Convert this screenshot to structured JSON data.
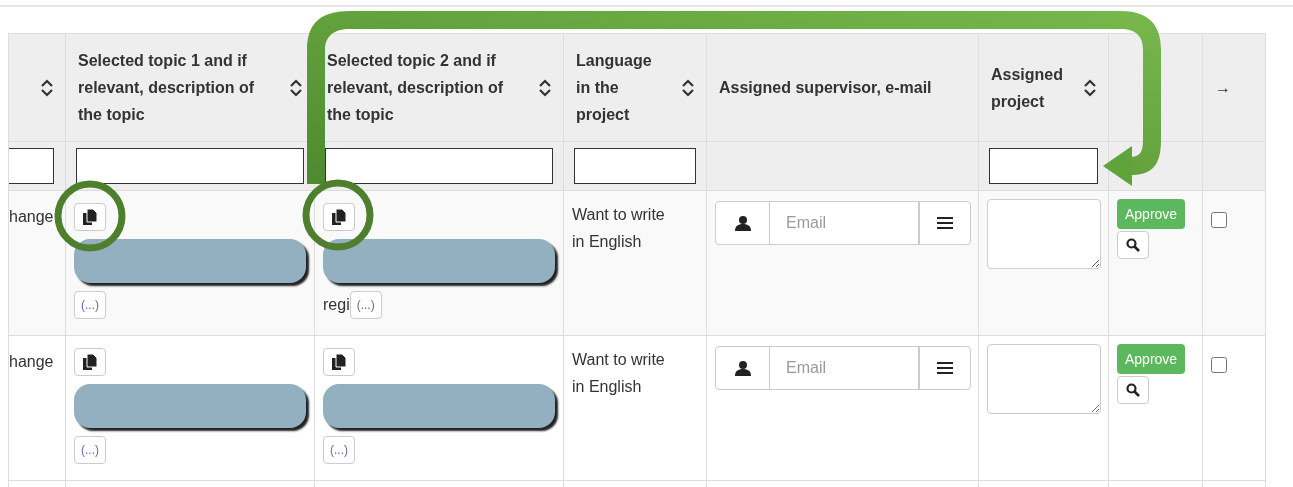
{
  "table": {
    "columns": [
      {
        "sortable": true,
        "filter": true
      },
      {
        "label": "Selected topic 1 and if relevant, description of the topic",
        "sortable": true,
        "filter": true
      },
      {
        "label": "Selected topic 2 and if relevant, description of the topic",
        "sortable": true,
        "filter": true
      },
      {
        "label": "Language in the project",
        "sortable": true,
        "filter": true
      },
      {
        "label": "Assigned supervisor, e-mail",
        "sortable": false,
        "filter": false
      },
      {
        "label": "Assigned project",
        "sortable": true,
        "filter": true
      },
      {
        "sortable": false,
        "filter": false
      },
      {
        "label": "→",
        "sortable": false,
        "filter": false
      }
    ],
    "rows": [
      {
        "column_1": "hange",
        "topic_1": {
          "more": "(...)"
        },
        "topic_2": {
          "prefix": "regi",
          "more": "(...)"
        },
        "language": "Want to write in English",
        "supervisor": {
          "placeholder": "Email"
        },
        "approve": "Approve",
        "checked": false
      },
      {
        "column_1": "hange",
        "topic_1": {
          "more": "(...)"
        },
        "topic_2": {
          "more": "(...)"
        },
        "language": "Want to write in English",
        "supervisor": {
          "placeholder": "Email"
        },
        "approve": "Approve",
        "checked": false
      }
    ]
  }
}
